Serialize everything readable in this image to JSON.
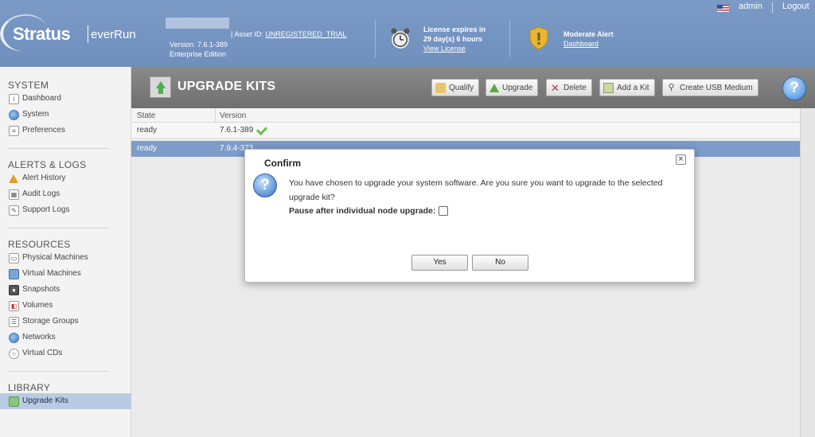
{
  "header": {
    "brand": "Stratus",
    "product": "everRun",
    "version": "Version: 7.6.1-389",
    "edition": "Enterprise Edition",
    "asset_label": "| Asset ID:",
    "asset_value": "UNREGISTERED_TRIAL",
    "license_line1": "License expires in",
    "license_line2": "29 day(s) 6 hours",
    "license_link": "View License",
    "alert_title": "Moderate Alert",
    "alert_link": "Dashboard",
    "user": "admin",
    "logout": "Logout"
  },
  "sidebar": {
    "sections": [
      {
        "title": "SYSTEM",
        "items": [
          "Dashboard",
          "System",
          "Preferences"
        ]
      },
      {
        "title": "ALERTS & LOGS",
        "items": [
          "Alert History",
          "Audit Logs",
          "Support Logs"
        ]
      },
      {
        "title": "RESOURCES",
        "items": [
          "Physical Machines",
          "Virtual Machines",
          "Snapshots",
          "Volumes",
          "Storage Groups",
          "Networks",
          "Virtual CDs"
        ]
      },
      {
        "title": "LIBRARY",
        "items": [
          "Upgrade Kits"
        ]
      }
    ]
  },
  "main": {
    "title": "UPGRADE KITS",
    "toolbar": [
      "Qualify",
      "Upgrade",
      "Delete",
      "Add a Kit",
      "Create USB Medium"
    ],
    "help": "?",
    "table": {
      "columns": [
        "State",
        "Version"
      ],
      "rows": [
        {
          "state": "ready",
          "version": "7.6.1-389"
        },
        {
          "state": "ready",
          "version": "7.9.4-373"
        }
      ]
    }
  },
  "dialog": {
    "title": "Confirm",
    "close": "×",
    "icon": "?",
    "message": "You have chosen to upgrade your system software. Are you sure you want to upgrade to the selected upgrade kit?",
    "pause_label": "Pause after individual node upgrade:",
    "yes": "Yes",
    "no": "No"
  }
}
